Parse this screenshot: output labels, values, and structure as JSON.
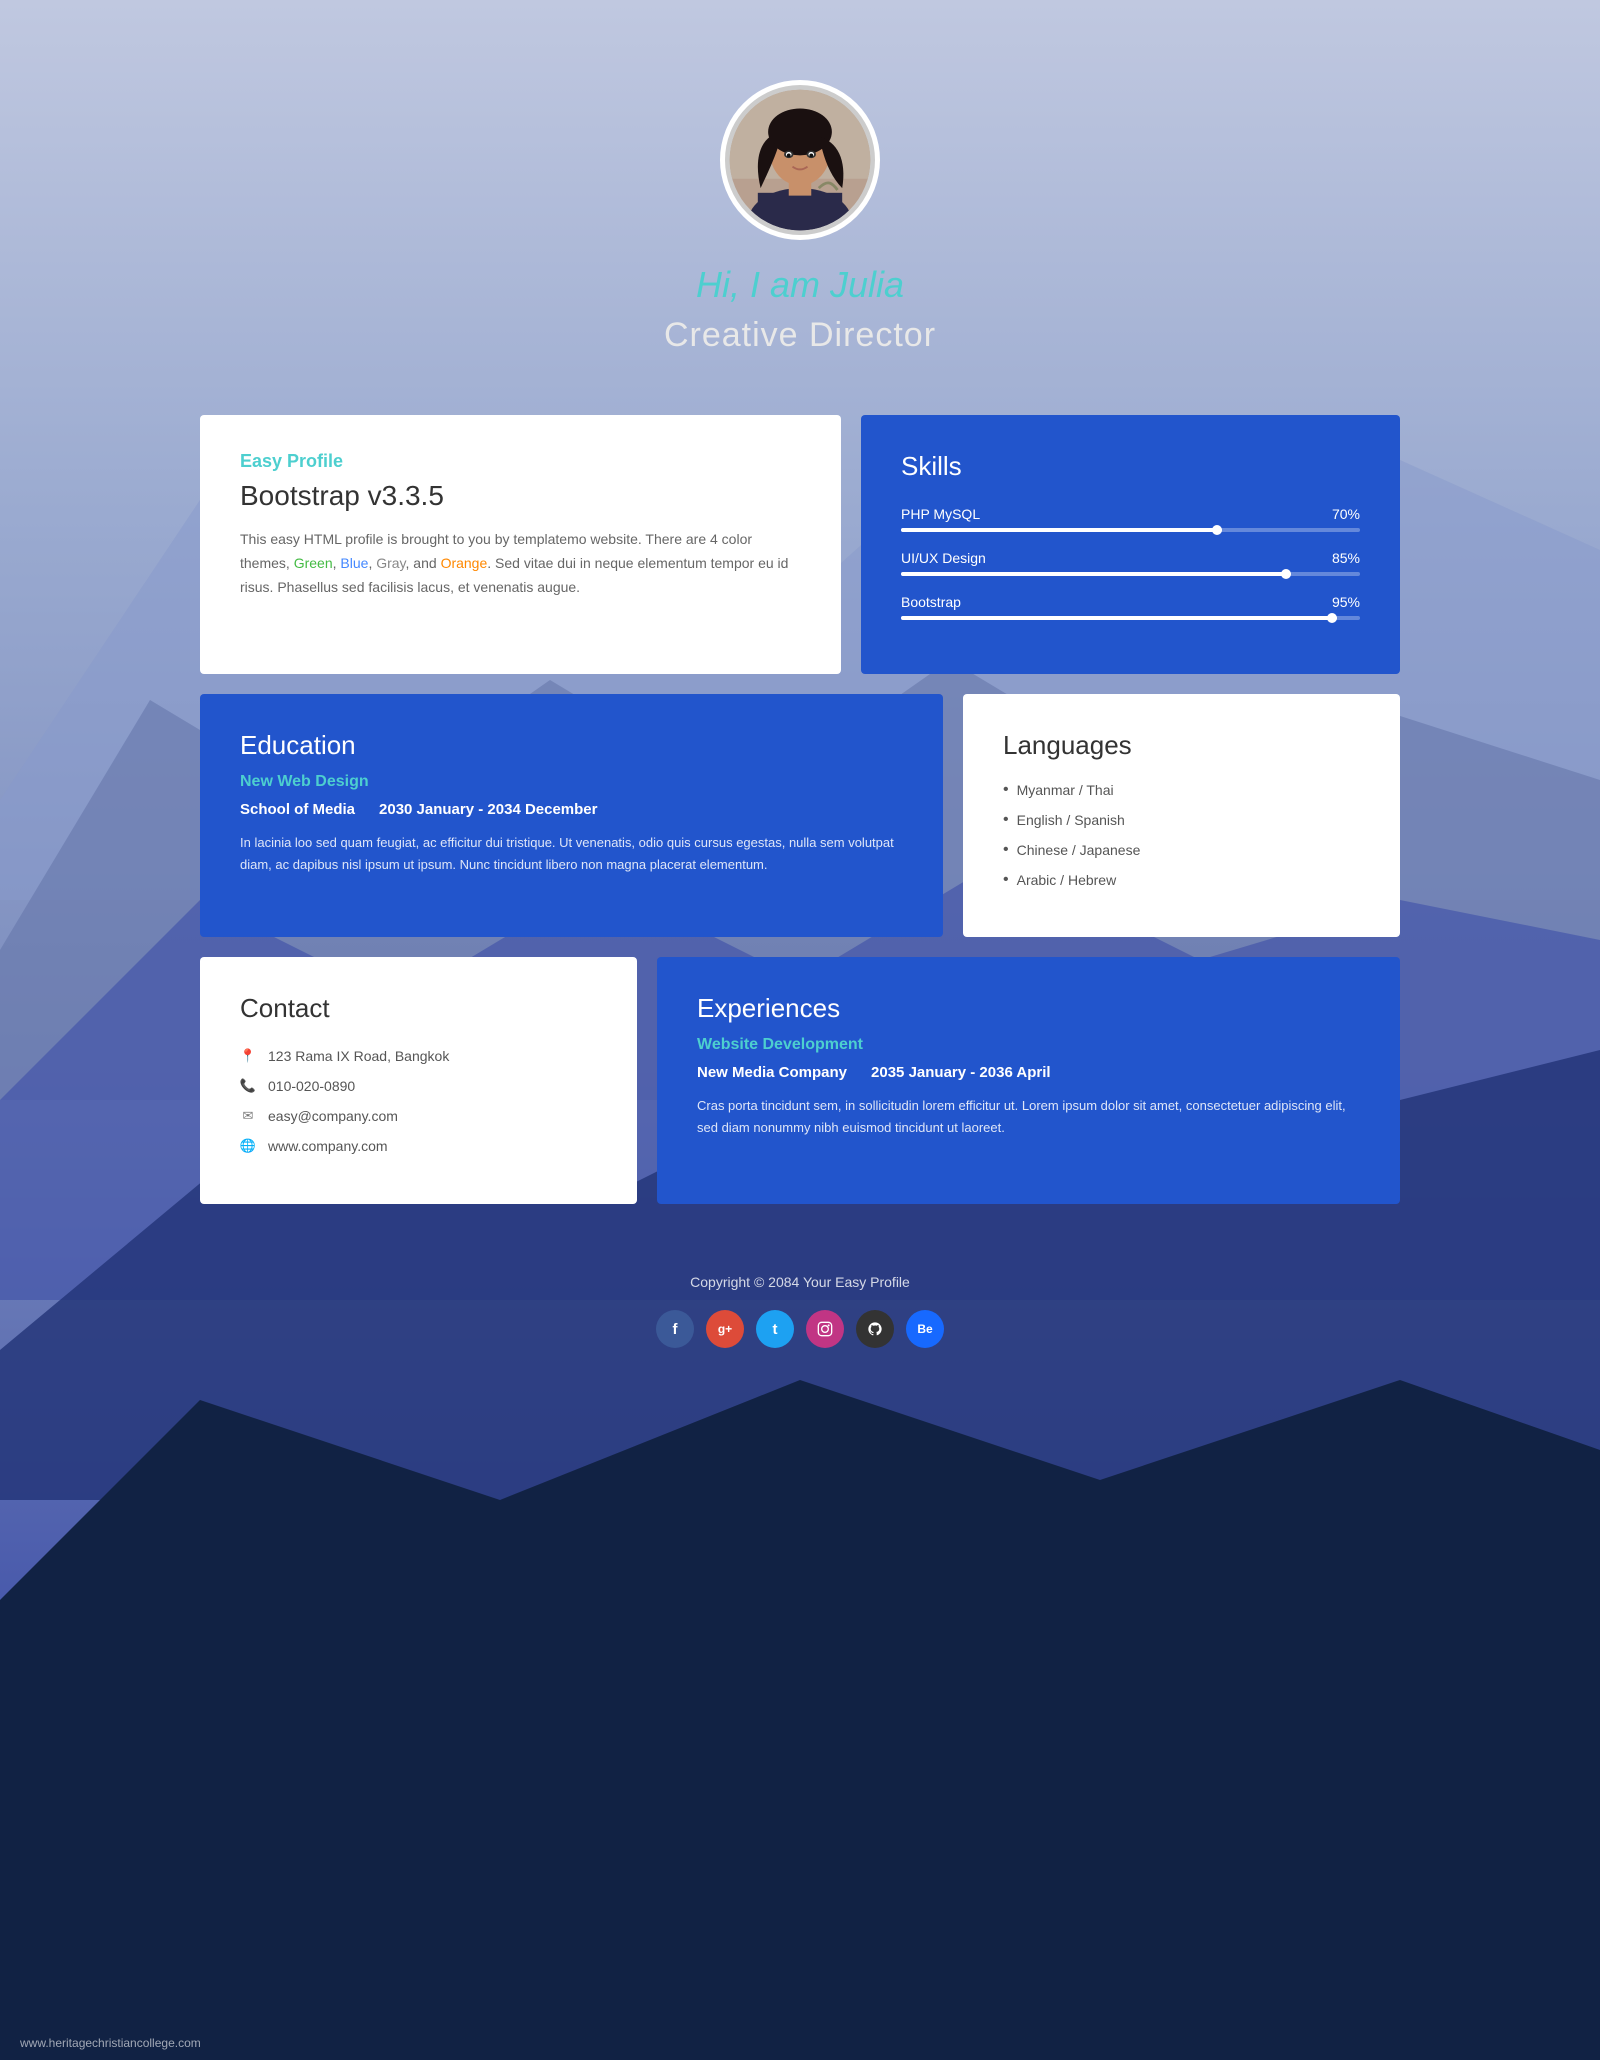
{
  "header": {
    "greeting": "Hi, I am Julia",
    "title": "Creative Director"
  },
  "easyProfile": {
    "tag": "Easy Profile",
    "title": "Bootstrap v3.3.5",
    "text": "This easy HTML profile is brought to you by templatemo website. There are 4 color themes,",
    "colors": [
      "Green",
      "Blue",
      "Gray",
      "Orange"
    ],
    "text2": ". Sed vitae dui in neque elementum tempor eu id risus. Phasellus sed facilisis lacus, et venenatis augue."
  },
  "skills": {
    "title": "Skills",
    "items": [
      {
        "name": "PHP MySQL",
        "percent": 70,
        "label": "70%"
      },
      {
        "name": "UI/UX Design",
        "percent": 85,
        "label": "85%"
      },
      {
        "name": "Bootstrap",
        "percent": 95,
        "label": "95%"
      }
    ]
  },
  "education": {
    "title": "Education",
    "subtitle": "New Web Design",
    "school": "School of Media",
    "dates": "2030 January - 2034 December",
    "body": "In lacinia loo sed quam feugiat, ac efficitur dui tristique. Ut venenatis, odio quis cursus egestas, nulla sem volutpat diam, ac dapibus nisl ipsum ut ipsum. Nunc tincidunt libero non magna placerat elementum."
  },
  "languages": {
    "title": "Languages",
    "items": [
      "Myanmar / Thai",
      "English / Spanish",
      "Chinese / Japanese",
      "Arabic / Hebrew"
    ]
  },
  "contact": {
    "title": "Contact",
    "address": "123 Rama IX Road, Bangkok",
    "phone": "010-020-0890",
    "email": "easy@company.com",
    "website": "www.company.com"
  },
  "experiences": {
    "title": "Experiences",
    "subtitle": "Website Development",
    "company": "New Media Company",
    "dates": "2035 January - 2036 April",
    "body": "Cras porta tincidunt sem, in sollicitudin lorem efficitur ut. Lorem ipsum dolor sit amet, consectetuer adipiscing elit, sed diam nonummy nibh euismod tincidunt ut laoreet."
  },
  "footer": {
    "copyright": "Copyright © 2084 Your Easy Profile",
    "url": "www.heritagechristiancollege.com",
    "social": [
      {
        "name": "Facebook",
        "icon": "f",
        "class": "facebook"
      },
      {
        "name": "Google+",
        "icon": "g+",
        "class": "google"
      },
      {
        "name": "Twitter",
        "icon": "t",
        "class": "twitter"
      },
      {
        "name": "Instagram",
        "icon": "◎",
        "class": "instagram"
      },
      {
        "name": "GitHub",
        "icon": "⌥",
        "class": "github"
      },
      {
        "name": "Behance",
        "icon": "Be",
        "class": "behance"
      }
    ]
  }
}
